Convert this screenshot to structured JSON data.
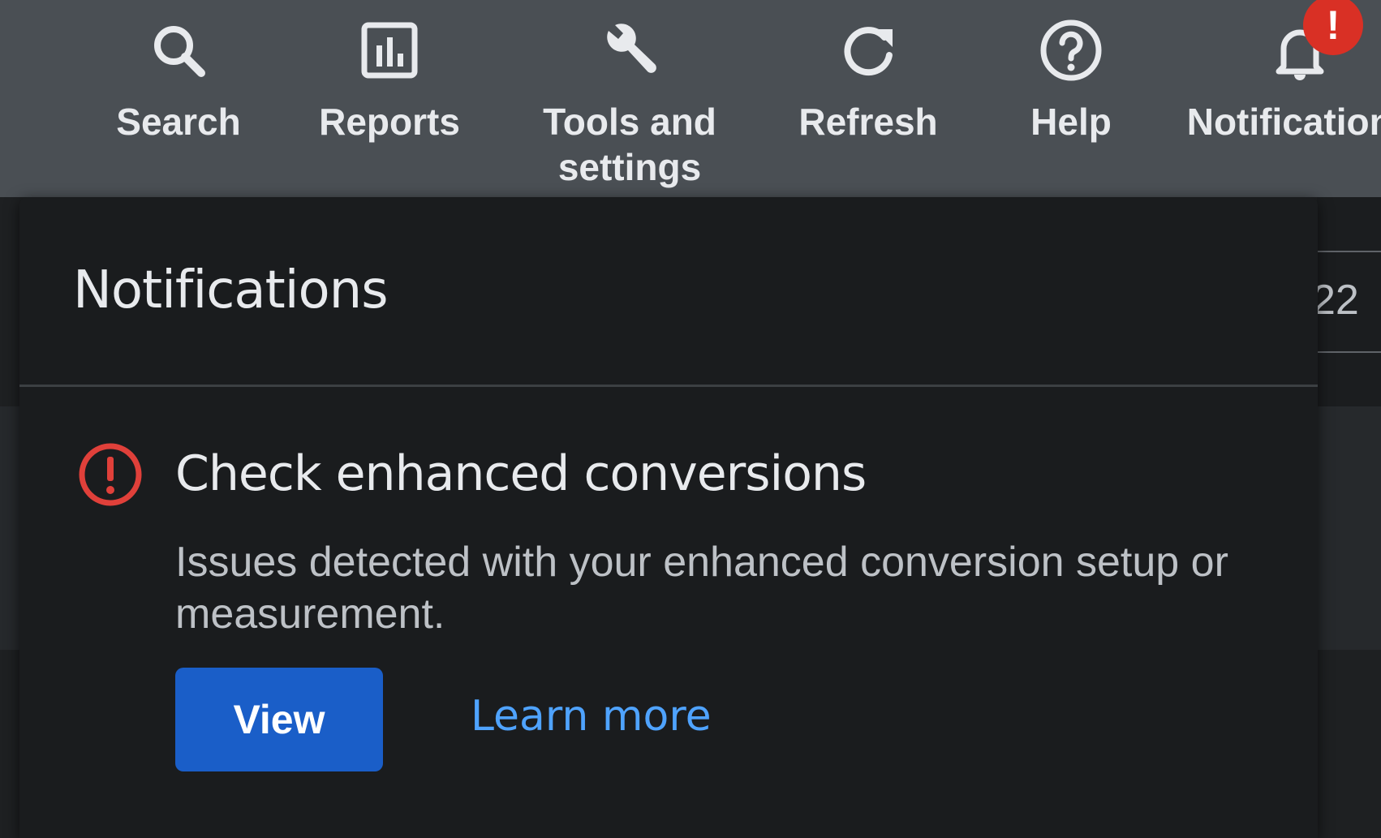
{
  "toolbar": {
    "items": [
      {
        "label": "Search",
        "icon": "search-icon"
      },
      {
        "label": "Reports",
        "icon": "bar-chart-icon"
      },
      {
        "label": "Tools and settings",
        "icon": "wrench-icon"
      },
      {
        "label": "Refresh",
        "icon": "refresh-icon"
      },
      {
        "label": "Help",
        "icon": "help-icon"
      },
      {
        "label": "Notifications",
        "icon": "bell-icon"
      }
    ],
    "alert_badge": "!"
  },
  "background": {
    "partial_value": "22"
  },
  "notifications_panel": {
    "title": "Notifications",
    "item": {
      "icon": "error-circle-icon",
      "title": "Check enhanced conversions",
      "body": "Issues detected with your enhanced conversion setup or measurement.",
      "view_label": "View",
      "learn_more_label": "Learn more"
    }
  },
  "colors": {
    "toolbar_bg": "#4a4f54",
    "panel_bg": "#1a1c1e",
    "alert_red": "#d93025",
    "primary_button": "#1a5ec8",
    "link_blue": "#4fa3ff"
  }
}
